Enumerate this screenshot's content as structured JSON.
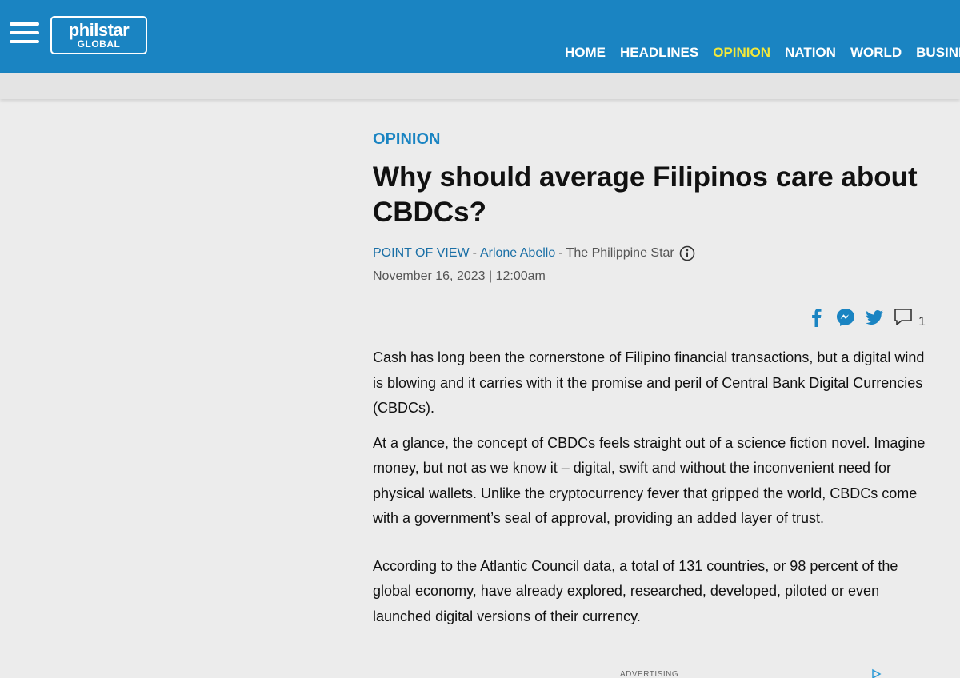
{
  "header": {
    "logo": {
      "main": "philstar",
      "sub": "GLOBAL"
    },
    "nav": [
      {
        "label": "HOME",
        "active": false
      },
      {
        "label": "HEADLINES",
        "active": false
      },
      {
        "label": "OPINION",
        "active": true
      },
      {
        "label": "NATION",
        "active": false
      },
      {
        "label": "WORLD",
        "active": false
      },
      {
        "label": "BUSINESS",
        "active": false
      }
    ],
    "colors": {
      "bar": "#1a84c2",
      "active_nav": "#f3e83a"
    }
  },
  "article": {
    "section": "OPINION",
    "title": "Why should average Filipinos care about CBDCs?",
    "column": "POINT OF VIEW",
    "author": "Arlone Abello",
    "publication": "The Philippine Star",
    "date": "November 16, 2023 | 12:00am",
    "comment_count": "1",
    "paragraphs": [
      "Cash has long been the cornerstone of Filipino financial transactions, but a digital wind is blowing and it carries with it the promise and peril of Central Bank Digital Currencies (CBDCs).",
      "At a glance, the concept of CBDCs feels straight out of a science fiction novel. Imagine money, but not as we know it – digital, swift and without the inconvenient need for physical wallets. Unlike the cryptocurrency fever that gripped the world, CBDCs come with a government’s seal of approval, providing an added layer of trust.",
      "According to the Atlantic Council data, a total of 131 countries, or 98 percent of the global economy, have already explored, researched, developed, piloted or even launched digital versions of their currency."
    ]
  },
  "share_icons": [
    "facebook-icon",
    "messenger-icon",
    "twitter-icon",
    "comment-icon"
  ],
  "ad": {
    "label": "ADVERTISING"
  }
}
